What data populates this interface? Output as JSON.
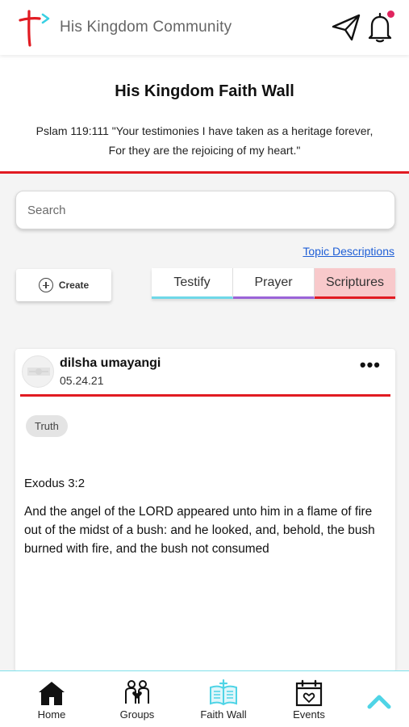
{
  "header": {
    "app_title": "His Kingdom Community",
    "notification_badge_color": "#e0245e"
  },
  "wall": {
    "title": "His Kingdom Faith Wall",
    "verse_line1": "Pslam 119:111 \"Your testimonies I have taken as a heritage forever,",
    "verse_line2": "For they are the rejoicing of my heart.\""
  },
  "search": {
    "placeholder": "Search"
  },
  "topic_link": "Topic Descriptions",
  "create_label": "Create",
  "tabs": [
    {
      "label": "Testify",
      "accent": "#6fd8e8"
    },
    {
      "label": "Prayer",
      "accent": "#9b63d8"
    },
    {
      "label": "Scriptures",
      "accent": "#e11b22",
      "selected": true
    }
  ],
  "post": {
    "author": "dilsha umayangi",
    "date": "05.24.21",
    "more_label": "•••",
    "tag": "Truth",
    "reference": "Exodus 3:2",
    "text": "And the angel of the LORD appeared unto him in a flame of fire out of the midst of a bush: and he looked, and, behold, the bush burned with fire, and the bush not consumed"
  },
  "nav": {
    "items": [
      {
        "label": "Home",
        "icon": "home-icon"
      },
      {
        "label": "Groups",
        "icon": "groups-icon"
      },
      {
        "label": "Faith Wall",
        "icon": "faith-wall-icon",
        "active": true
      },
      {
        "label": "Events",
        "icon": "events-icon"
      }
    ],
    "scroll_top_icon": "chevron-up-icon",
    "accent_color": "#4fd4e6"
  },
  "colors": {
    "brand_red": "#e11b22",
    "brand_cyan": "#39d0e3"
  }
}
